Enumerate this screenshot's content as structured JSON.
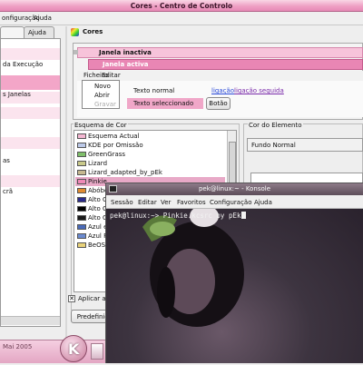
{
  "window": {
    "title": "Cores - Centro de Controlo"
  },
  "menubar": {
    "items": [
      "onfiguração",
      "Ajuda"
    ]
  },
  "left": {
    "tabs": [
      "",
      "Ajuda"
    ],
    "items": [
      {
        "label": "",
        "style": "pink"
      },
      {
        "label": "",
        "style": "plain"
      },
      {
        "label": "da Execução",
        "style": "plain"
      },
      {
        "label": "",
        "style": "sel"
      },
      {
        "label": "",
        "style": "pink"
      },
      {
        "label": "s Janelas",
        "style": "plain"
      },
      {
        "label": "",
        "style": "pink"
      },
      {
        "label": "",
        "style": "plain"
      },
      {
        "label": "",
        "style": "pink"
      },
      {
        "label": "",
        "style": "plain"
      },
      {
        "label": "as",
        "style": "plain"
      },
      {
        "label": "",
        "style": "pink"
      },
      {
        "label": "",
        "style": "plain"
      },
      {
        "label": "crã",
        "style": "plain"
      }
    ]
  },
  "header": {
    "title": "Cores"
  },
  "preview": {
    "inactive_title": "Janela inactiva",
    "active_title": "Janela activa",
    "menu": [
      "Ficheiro",
      "Editar"
    ],
    "dropdown": [
      "Novo",
      "Abrir",
      "Gravar"
    ],
    "normal_text": "Texto normal",
    "selected_text": "Texto seleccionado",
    "button": "Botão",
    "link": "ligação",
    "visited_link": "ligação seguida"
  },
  "scheme": {
    "group_label": "Esquema de Cor",
    "items": [
      {
        "name": "Esquema Actual",
        "color": "#f4b7d2"
      },
      {
        "name": "KDE por Omissão",
        "color": "#bcc9e8"
      },
      {
        "name": "GreenGrass",
        "color": "#7fbf6a"
      },
      {
        "name": "Lizard",
        "color": "#c9c98a"
      },
      {
        "name": "Lizard_adapted_by_pEk",
        "color": "#c6b88f"
      },
      {
        "name": "Pinkie",
        "color": "#f08ab8",
        "selected": true
      },
      {
        "name": "Abóbo",
        "color": "#e08a30"
      },
      {
        "name": "Alto C",
        "color": "#2a2a8a"
      },
      {
        "name": "Alto C",
        "color": "#000000"
      },
      {
        "name": "Alto C",
        "color": "#1a1a1a"
      },
      {
        "name": "Azul e",
        "color": "#4a6ab8"
      },
      {
        "name": "Azul F",
        "color": "#6a8ad0"
      },
      {
        "name": "BeOS",
        "color": "#e8d27a"
      }
    ],
    "checkbox_label": "Aplicar as"
  },
  "element": {
    "group_label": "Cor do Elemento",
    "selected": "Fundo Normal"
  },
  "buttons": {
    "defaults": "Predefiniç"
  },
  "taskbar": {
    "date": "Mai 2005"
  },
  "konsole": {
    "title": "pek@linux:~ - Konsole",
    "menu": [
      "Sessão",
      "Editar",
      "Ver",
      "Favoritos",
      "Configuração",
      "Ajuda"
    ],
    "line": "pek@linux:~> Pinkie.kcsrc by pEk"
  },
  "colors": {
    "accent": "#e986b4",
    "title_bg": "#ee9cc2",
    "console_bg": "#2a222d"
  }
}
